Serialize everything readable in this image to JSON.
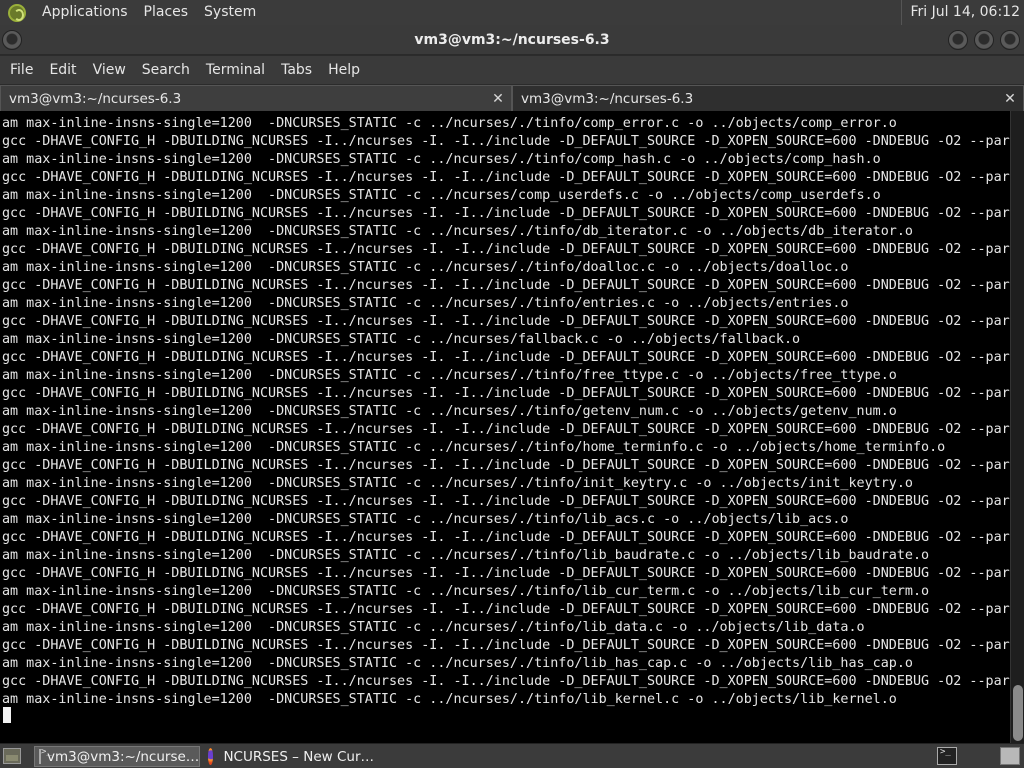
{
  "top_panel": {
    "menus": [
      "Applications",
      "Places",
      "System"
    ],
    "clock": "Fri Jul 14, 06:12"
  },
  "window": {
    "title": "vm3@vm3:~/ncurses-6.3"
  },
  "menubar": {
    "items": [
      "File",
      "Edit",
      "View",
      "Search",
      "Terminal",
      "Tabs",
      "Help"
    ]
  },
  "tabs": [
    {
      "label": "vm3@vm3:~/ncurses-6.3",
      "close": "✕",
      "active": true
    },
    {
      "label": "vm3@vm3:~/ncurses-6.3",
      "close": "✕",
      "active": false
    }
  ],
  "terminal": {
    "lines": [
      "am max-inline-insns-single=1200  -DNCURSES_STATIC -c ../ncurses/./tinfo/comp_error.c -o ../objects/comp_error.o",
      "gcc -DHAVE_CONFIG_H -DBUILDING_NCURSES -I../ncurses -I. -I../include -D_DEFAULT_SOURCE -D_XOPEN_SOURCE=600 -DNDEBUG -O2 --par",
      "am max-inline-insns-single=1200  -DNCURSES_STATIC -c ../ncurses/./tinfo/comp_hash.c -o ../objects/comp_hash.o",
      "gcc -DHAVE_CONFIG_H -DBUILDING_NCURSES -I../ncurses -I. -I../include -D_DEFAULT_SOURCE -D_XOPEN_SOURCE=600 -DNDEBUG -O2 --par",
      "am max-inline-insns-single=1200  -DNCURSES_STATIC -c ../ncurses/comp_userdefs.c -o ../objects/comp_userdefs.o",
      "gcc -DHAVE_CONFIG_H -DBUILDING_NCURSES -I../ncurses -I. -I../include -D_DEFAULT_SOURCE -D_XOPEN_SOURCE=600 -DNDEBUG -O2 --par",
      "am max-inline-insns-single=1200  -DNCURSES_STATIC -c ../ncurses/./tinfo/db_iterator.c -o ../objects/db_iterator.o",
      "gcc -DHAVE_CONFIG_H -DBUILDING_NCURSES -I../ncurses -I. -I../include -D_DEFAULT_SOURCE -D_XOPEN_SOURCE=600 -DNDEBUG -O2 --par",
      "am max-inline-insns-single=1200  -DNCURSES_STATIC -c ../ncurses/./tinfo/doalloc.c -o ../objects/doalloc.o",
      "gcc -DHAVE_CONFIG_H -DBUILDING_NCURSES -I../ncurses -I. -I../include -D_DEFAULT_SOURCE -D_XOPEN_SOURCE=600 -DNDEBUG -O2 --par",
      "am max-inline-insns-single=1200  -DNCURSES_STATIC -c ../ncurses/./tinfo/entries.c -o ../objects/entries.o",
      "gcc -DHAVE_CONFIG_H -DBUILDING_NCURSES -I../ncurses -I. -I../include -D_DEFAULT_SOURCE -D_XOPEN_SOURCE=600 -DNDEBUG -O2 --par",
      "am max-inline-insns-single=1200  -DNCURSES_STATIC -c ../ncurses/fallback.c -o ../objects/fallback.o",
      "gcc -DHAVE_CONFIG_H -DBUILDING_NCURSES -I../ncurses -I. -I../include -D_DEFAULT_SOURCE -D_XOPEN_SOURCE=600 -DNDEBUG -O2 --par",
      "am max-inline-insns-single=1200  -DNCURSES_STATIC -c ../ncurses/./tinfo/free_ttype.c -o ../objects/free_ttype.o",
      "gcc -DHAVE_CONFIG_H -DBUILDING_NCURSES -I../ncurses -I. -I../include -D_DEFAULT_SOURCE -D_XOPEN_SOURCE=600 -DNDEBUG -O2 --par",
      "am max-inline-insns-single=1200  -DNCURSES_STATIC -c ../ncurses/./tinfo/getenv_num.c -o ../objects/getenv_num.o",
      "gcc -DHAVE_CONFIG_H -DBUILDING_NCURSES -I../ncurses -I. -I../include -D_DEFAULT_SOURCE -D_XOPEN_SOURCE=600 -DNDEBUG -O2 --par",
      "am max-inline-insns-single=1200  -DNCURSES_STATIC -c ../ncurses/./tinfo/home_terminfo.c -o ../objects/home_terminfo.o",
      "gcc -DHAVE_CONFIG_H -DBUILDING_NCURSES -I../ncurses -I. -I../include -D_DEFAULT_SOURCE -D_XOPEN_SOURCE=600 -DNDEBUG -O2 --par",
      "am max-inline-insns-single=1200  -DNCURSES_STATIC -c ../ncurses/./tinfo/init_keytry.c -o ../objects/init_keytry.o",
      "gcc -DHAVE_CONFIG_H -DBUILDING_NCURSES -I../ncurses -I. -I../include -D_DEFAULT_SOURCE -D_XOPEN_SOURCE=600 -DNDEBUG -O2 --par",
      "am max-inline-insns-single=1200  -DNCURSES_STATIC -c ../ncurses/./tinfo/lib_acs.c -o ../objects/lib_acs.o",
      "gcc -DHAVE_CONFIG_H -DBUILDING_NCURSES -I../ncurses -I. -I../include -D_DEFAULT_SOURCE -D_XOPEN_SOURCE=600 -DNDEBUG -O2 --par",
      "am max-inline-insns-single=1200  -DNCURSES_STATIC -c ../ncurses/./tinfo/lib_baudrate.c -o ../objects/lib_baudrate.o",
      "gcc -DHAVE_CONFIG_H -DBUILDING_NCURSES -I../ncurses -I. -I../include -D_DEFAULT_SOURCE -D_XOPEN_SOURCE=600 -DNDEBUG -O2 --par",
      "am max-inline-insns-single=1200  -DNCURSES_STATIC -c ../ncurses/./tinfo/lib_cur_term.c -o ../objects/lib_cur_term.o",
      "gcc -DHAVE_CONFIG_H -DBUILDING_NCURSES -I../ncurses -I. -I../include -D_DEFAULT_SOURCE -D_XOPEN_SOURCE=600 -DNDEBUG -O2 --par",
      "am max-inline-insns-single=1200  -DNCURSES_STATIC -c ../ncurses/./tinfo/lib_data.c -o ../objects/lib_data.o",
      "gcc -DHAVE_CONFIG_H -DBUILDING_NCURSES -I../ncurses -I. -I../include -D_DEFAULT_SOURCE -D_XOPEN_SOURCE=600 -DNDEBUG -O2 --par",
      "am max-inline-insns-single=1200  -DNCURSES_STATIC -c ../ncurses/./tinfo/lib_has_cap.c -o ../objects/lib_has_cap.o",
      "gcc -DHAVE_CONFIG_H -DBUILDING_NCURSES -I../ncurses -I. -I../include -D_DEFAULT_SOURCE -D_XOPEN_SOURCE=600 -DNDEBUG -O2 --par",
      "am max-inline-insns-single=1200  -DNCURSES_STATIC -c ../ncurses/./tinfo/lib_kernel.c -o ../objects/lib_kernel.o"
    ]
  },
  "taskbar": {
    "tasks": [
      {
        "label": "vm3@vm3:~/ncurse…",
        "icon": "terminal-icon",
        "active": true
      },
      {
        "label": "NCURSES – New Cur…",
        "icon": "firefox-icon",
        "active": false
      }
    ]
  }
}
